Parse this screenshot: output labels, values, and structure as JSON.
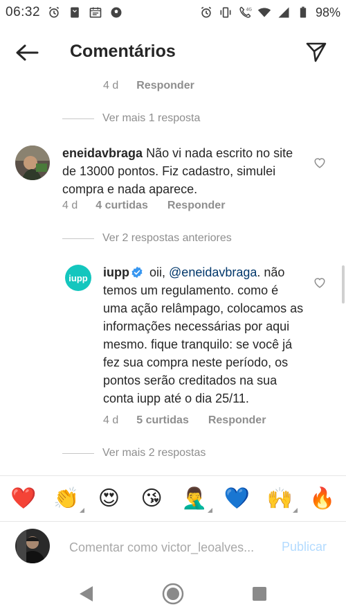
{
  "status_bar": {
    "time": "06:32",
    "battery": "98%",
    "network": "4G"
  },
  "header": {
    "title": "Comentários"
  },
  "top_meta": {
    "time": "4 d",
    "reply_label": "Responder"
  },
  "more_replies_1": "Ver mais 1 resposta",
  "comment_1": {
    "username": "eneidavbraga",
    "text": "Não vi nada escrito no site de 13000 pontos. Fiz cadastro, simulei compra e nada aparece.",
    "time": "4 d",
    "likes": "4 curtidas",
    "reply_label": "Responder"
  },
  "previous_replies": "Ver 2 respostas anteriores",
  "reply_1": {
    "avatar_text": "iupp",
    "username": "iupp",
    "mention": "@eneidavbraga",
    "text_before_mention": "oii, ",
    "text_after_mention": ". não temos um regulamento. como é uma ação relâmpago, colocamos as informações necessárias por aqui mesmo. fique tranquilo: se você já fez sua compra neste período, os pontos serão creditados na sua conta iupp até o dia 25/11.",
    "time": "4 d",
    "likes": "5 curtidas",
    "reply_label": "Responder"
  },
  "more_replies_2": "Ver mais 2 respostas",
  "emoji_bar": [
    "❤️",
    "👏",
    "😍",
    "😘",
    "🤦‍♂️",
    "💙",
    "🙌",
    "🔥"
  ],
  "compose": {
    "placeholder": "Comentar como victor_leoalves...",
    "publish_label": "Publicar"
  },
  "colors": {
    "accent_link": "#00376b",
    "publish_disabled": "#b3dbff",
    "iupp_brand": "#14c6be",
    "verified": "#3897f0"
  }
}
